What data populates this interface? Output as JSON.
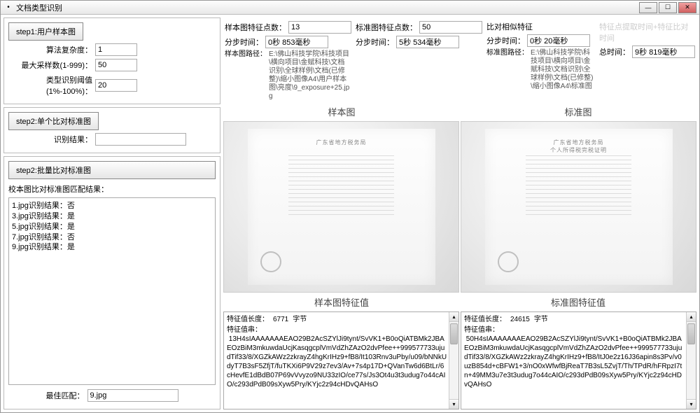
{
  "window": {
    "title": "文档类型识别"
  },
  "ctrl": {
    "min": "—",
    "max": "☐",
    "close": "✕"
  },
  "left": {
    "step1_btn": "step1:用户样本图",
    "algo_label": "算法复杂度：",
    "algo_val": "1",
    "max_samples_label": "最大采样数(1-999)：",
    "max_samples_val": "50",
    "thresh_label": "类型识别阈值(1%-100%)：",
    "thresh_val": "20",
    "step2_single_btn": "step2:单个比对标准图",
    "single_result_label": "识别结果：",
    "single_result_val": "",
    "step2_batch_btn": "step2:批量比对标准图",
    "batch_label": "校本图比对标准图匹配结果：",
    "batch_results": "1.jpg识别结果：否\n3.jpg识别结果：是\n5.jpg识别结果：是\n7.jpg识别结果：否\n9.jpg识别结果：是",
    "best_match_label": "最佳匹配：",
    "best_match_val": "9.jpg"
  },
  "top": {
    "sample_pts_label": "样本图特征点数：",
    "sample_pts": "13",
    "std_pts_label": "标准图特征点数：",
    "std_pts": "50",
    "compare_label": "比对相似特征",
    "time_hdr": "特征点提取时间+特征比对时间",
    "time_sample_label": "分步时间：",
    "time_sample": "0秒 853毫秒",
    "time_std_label": "分步时间：",
    "time_std": "5秒 534毫秒",
    "time_cmp_label": "分步时间：",
    "time_cmp": "0秒 20毫秒",
    "total_label": "总时间：",
    "total": "9秒 819毫秒",
    "sample_path_label": "样本图路径：",
    "sample_path": "E:\\佛山科技学院\\科技项目\\横向项目\\金赋科技\\文档识别\\全球样例\\文档(已修整)\\缩小图像A4\\用户样本图\\亮度\\9_exposure+25.jpg",
    "std_path_label": "标准图路径：",
    "std_path": "E:\\佛山科技学院\\科技项目\\横向项目\\金赋科技\\文档识别\\全球样例\\文档(已修整)\\缩小图像A4\\标准图"
  },
  "headings": {
    "sample_img": "样本图",
    "std_img": "标准图",
    "sample_feat": "样本图特征值",
    "std_feat": "标准图特征值"
  },
  "doc_sim": {
    "title_sample": "广东省地方税务局",
    "title_std": "广东省地方税务局\n个人所得税完税证明"
  },
  "feat": {
    "len_label": "特征值长度：",
    "unit": "字节",
    "str_label": "特征值串：",
    "sample_len": "6771",
    "sample_str": " 13H4sIAAAAAAAEAO29B2AcSZYlJi9tynt/SvVK1+B0oQiATBMk2JBAEOzBiM3mkuwdaUcjKasqgcplVmVdZhZAzO2dvPfee++999577733ujudTif33/8/XGZkAWz2zkrayZ4hgKrIHz9+fB8/It103Rnv3uPby/u09/bNNkUdyT7B3sF5ZfjT/fuTKXi6P9V29z7ev3/Av+7s4p17D+QVanTw6d6BtLr/6cHevfE1dBdB07P69vVvyzo9NU33zIO/ce77s/Js3Ot4u3t3udug7o44cAIO/c293dPdB09sXyw5Pry/KYjc2z94cHDvQAHsO",
    "std_len": "24615",
    "std_str": " 50H4sIAAAAAAAEAO29B2AcSZYlJi9tynt/SvVK1+B0oQiATBMk2JBAEOzBiM3mkuwdaUcjKasqgcplVmVdZhZAzO2dvPfee++999577733ujudTif33/8/XGZkAWz2zkrayZ4hgKrIHz9+fB8/ItJ0e2z16J36apin8s3Pv/v0uzB854d+cBFW1+3/nO0xWfwfBjReaT7B3sL5ZvjT/Th/TPdR/hFRpzI7tn+49MM3u7e3t3udug7o44cAIO/c293dPdB09sXyw5Pry/KYjc2z94cHDvQAHsO"
  }
}
